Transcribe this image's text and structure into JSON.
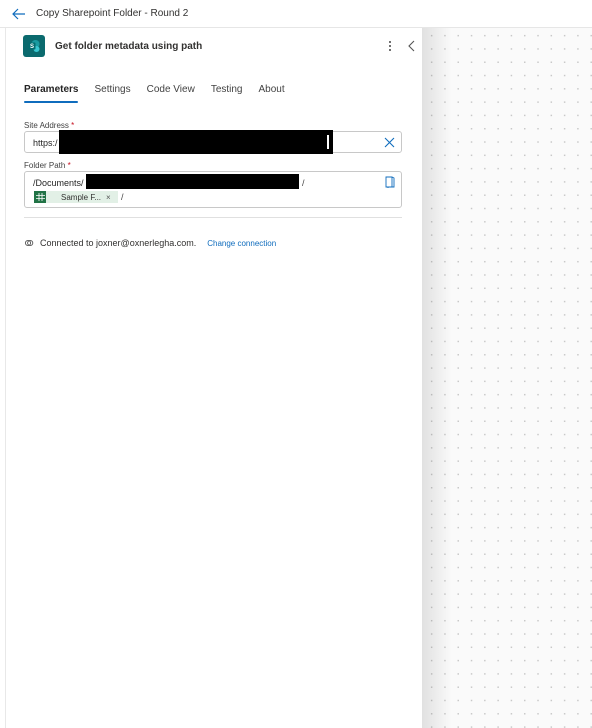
{
  "topbar": {
    "title": "Copy Sharepoint Folder - Round 2",
    "back_icon": "arrow-left-icon"
  },
  "panel": {
    "operation_title": "Get folder metadata using path",
    "connector_icon": "sharepoint-icon",
    "more_icon": "more-vertical-icon",
    "collapse_icon": "chevron-left-icon",
    "tabs": [
      {
        "label": "Parameters",
        "active": true
      },
      {
        "label": "Settings",
        "active": false
      },
      {
        "label": "Code View",
        "active": false
      },
      {
        "label": "Testing",
        "active": false
      },
      {
        "label": "About",
        "active": false
      }
    ],
    "site_address": {
      "label": "Site Address",
      "required_mark": "*",
      "value": "https:/",
      "redacted": true
    },
    "folder_path": {
      "label": "Folder Path",
      "required_mark": "*",
      "value_prefix": "/Documents/",
      "value_suffix": "/",
      "redacted": true,
      "token": {
        "label": "Sample F...",
        "remove": "×",
        "icon": "excel-icon"
      },
      "token_suffix": "/"
    },
    "connection": {
      "text": "Connected to joxner@oxnerlegha.com.",
      "change_label": "Change connection"
    }
  },
  "colors": {
    "accent": "#0f6cbd",
    "sharepoint": "#0b6a6e",
    "excel": "#217346",
    "required": "#c50f1f"
  }
}
